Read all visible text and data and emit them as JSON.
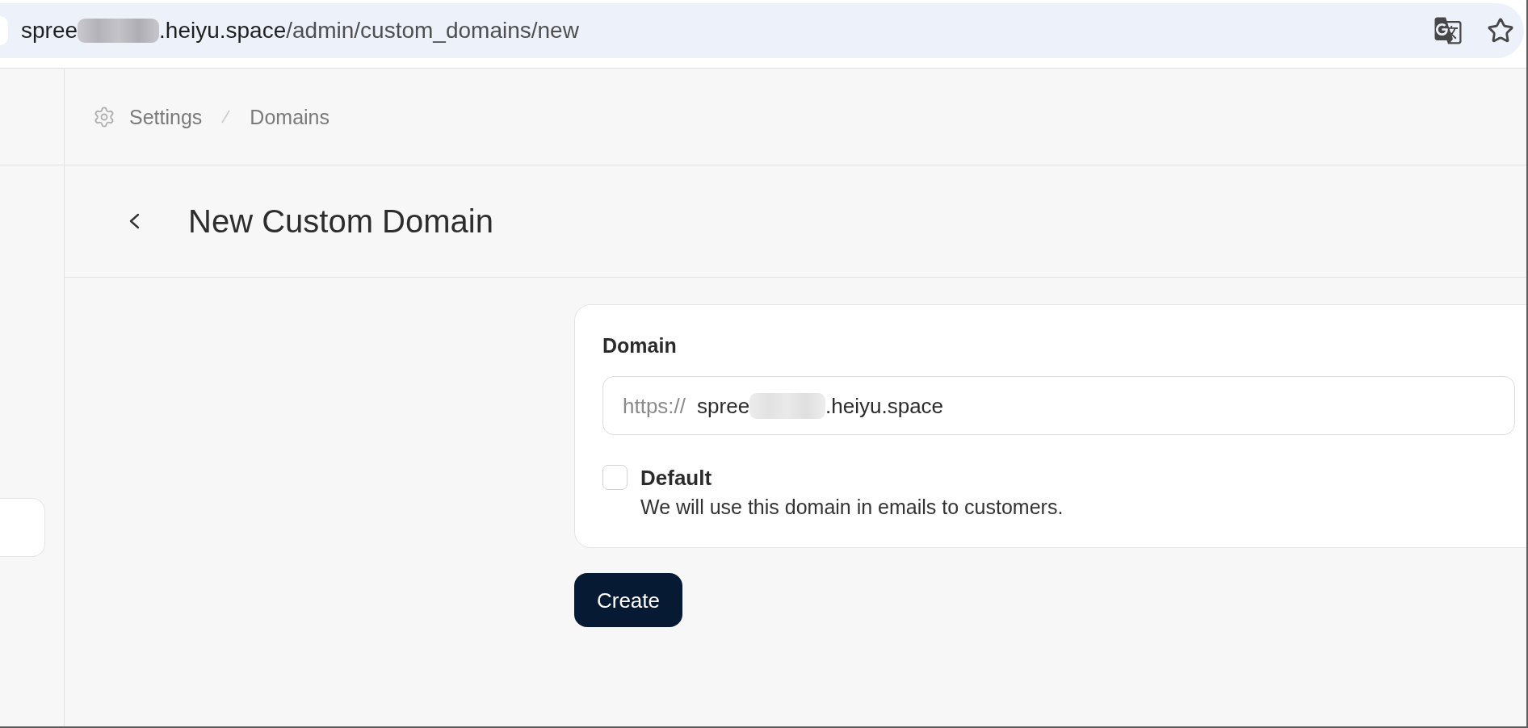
{
  "browser": {
    "url": {
      "host_start": "spree",
      "host_end": ".heiyu.space",
      "path": "/admin/custom_domains/new",
      "redacted": true
    }
  },
  "breadcrumb": [
    {
      "label": "Settings",
      "kind": "section"
    },
    {
      "label": "Domains",
      "kind": "page"
    }
  ],
  "header": {
    "title": "New Custom Domain"
  },
  "form": {
    "field": {
      "label": "Domain",
      "prefix": "https://",
      "value_start": "spree",
      "value_end": ".heiyu.space",
      "redacted": true
    },
    "option": {
      "label": "Default",
      "description": "We will use this domain in emails to customers.",
      "checked": false
    }
  },
  "actions": [
    {
      "label": "Create",
      "kind": "primary"
    }
  ]
}
